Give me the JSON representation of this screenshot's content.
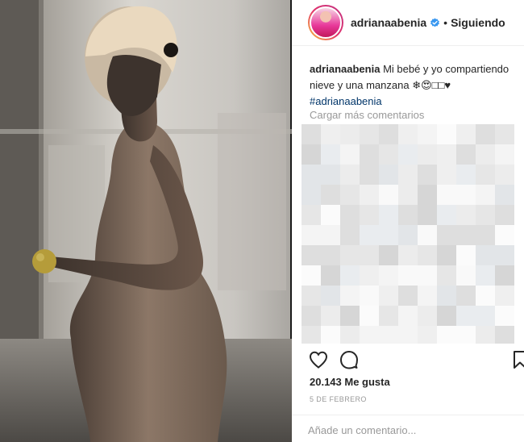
{
  "header": {
    "username": "adrianaabenia",
    "separator": "•",
    "follow_status": "Siguiendo"
  },
  "caption": {
    "username": "adrianaabenia",
    "text": "Mi bebé y yo compartiendo nieve y una manzana ❄😍□□♥",
    "hashtag": "#adrianaabenia"
  },
  "comments": {
    "load_more": "Cargar más comentarios"
  },
  "post": {
    "likes": "20.143 Me gusta",
    "date": "5 DE FEBRERO"
  },
  "comment_box": {
    "placeholder": "Añade un comentario..."
  },
  "colors": {
    "verified": "#3897f0",
    "link": "#003569",
    "muted": "#999999",
    "text": "#262626"
  },
  "icons": {
    "verified": "verified-badge-icon",
    "like": "heart-icon",
    "comment": "speech-bubble-icon",
    "save": "bookmark-icon"
  }
}
